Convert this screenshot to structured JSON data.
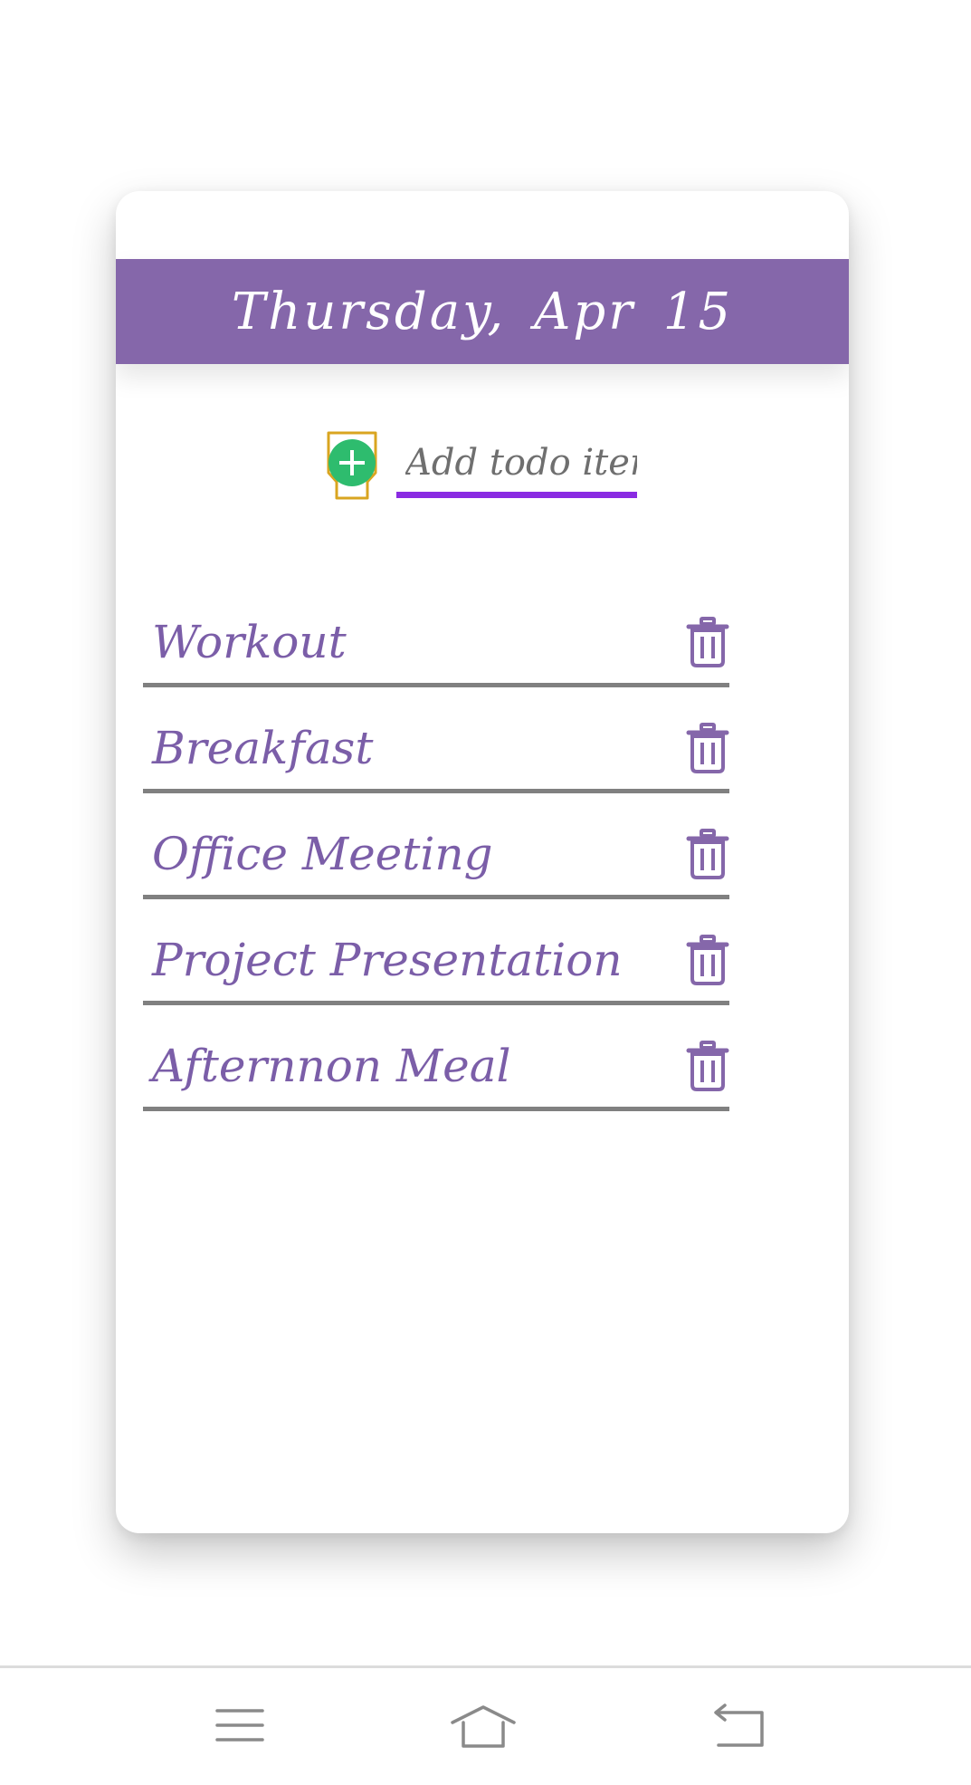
{
  "header": {
    "title": "Thursday, Apr 15"
  },
  "add_todo": {
    "placeholder": "Add todo item",
    "button_icon": "plus-icon"
  },
  "todos": [
    {
      "label": "Workout",
      "delete_icon": "trash-icon"
    },
    {
      "label": "Breakfast",
      "delete_icon": "trash-icon"
    },
    {
      "label": "Office Meeting",
      "delete_icon": "trash-icon"
    },
    {
      "label": "Project Presentation",
      "delete_icon": "trash-icon"
    },
    {
      "label": "Afternnon Meal",
      "delete_icon": "trash-icon"
    }
  ],
  "navigation": {
    "items": [
      "menu-icon",
      "home-icon",
      "back-icon"
    ]
  },
  "colors": {
    "header_background": "#8567aa",
    "accent_purple": "#8a2be2",
    "todo_text": "#7b5ea8",
    "add_button_green": "#2ebc6e",
    "add_button_border": "#d9a520"
  }
}
